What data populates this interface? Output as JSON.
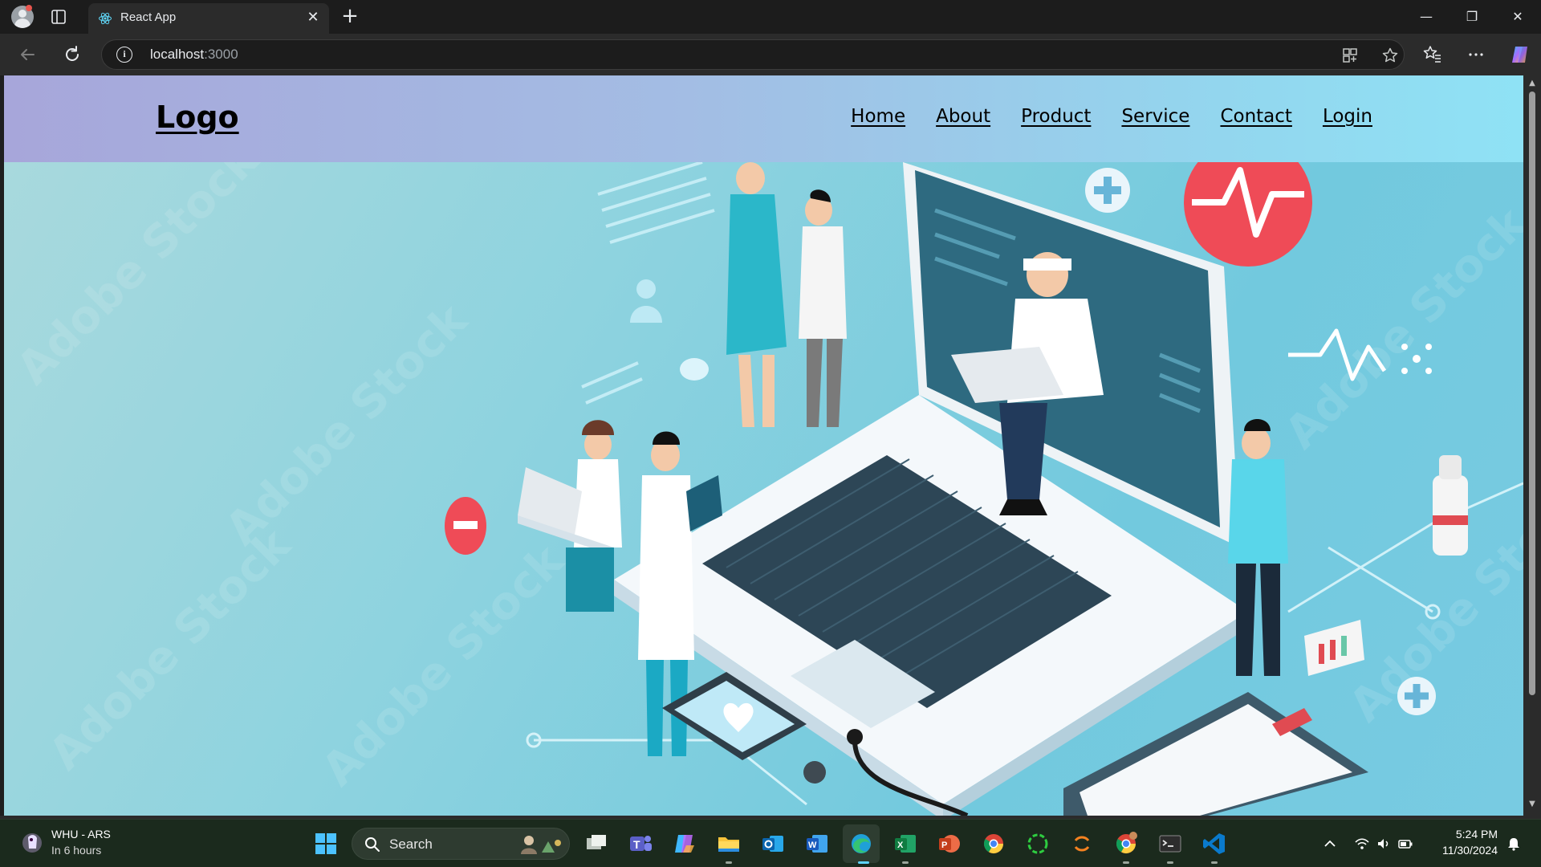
{
  "browser": {
    "tab_title": "React App",
    "tab_close": "✕",
    "new_tab": "+",
    "url_host": "localhost",
    "url_port": ":3000",
    "window_controls": {
      "minimize": "—",
      "restore": "❐",
      "close": "✕"
    }
  },
  "page": {
    "logo": "Logo",
    "nav": [
      {
        "label": "Home"
      },
      {
        "label": "About"
      },
      {
        "label": "Product"
      },
      {
        "label": "Service"
      },
      {
        "label": "Contact"
      },
      {
        "label": "Login"
      }
    ],
    "hero_image": "telemedicine-isometric-illustration",
    "colors": {
      "navbar_start": "#a7a6da",
      "navbar_end": "#8fe2f5",
      "hero": "#72c9de"
    }
  },
  "taskbar": {
    "weather_title": "WHU - ARS",
    "weather_sub": "In 6 hours",
    "search_label": "Search",
    "apps": [
      "task-view",
      "teams",
      "copilot",
      "file-explorer",
      "outlook",
      "word",
      "edge",
      "excel",
      "powerpoint",
      "chrome",
      "circle-app",
      "loading-app",
      "chrome-profile",
      "terminal",
      "vscode"
    ],
    "time": "5:24 PM",
    "date": "11/30/2024"
  }
}
